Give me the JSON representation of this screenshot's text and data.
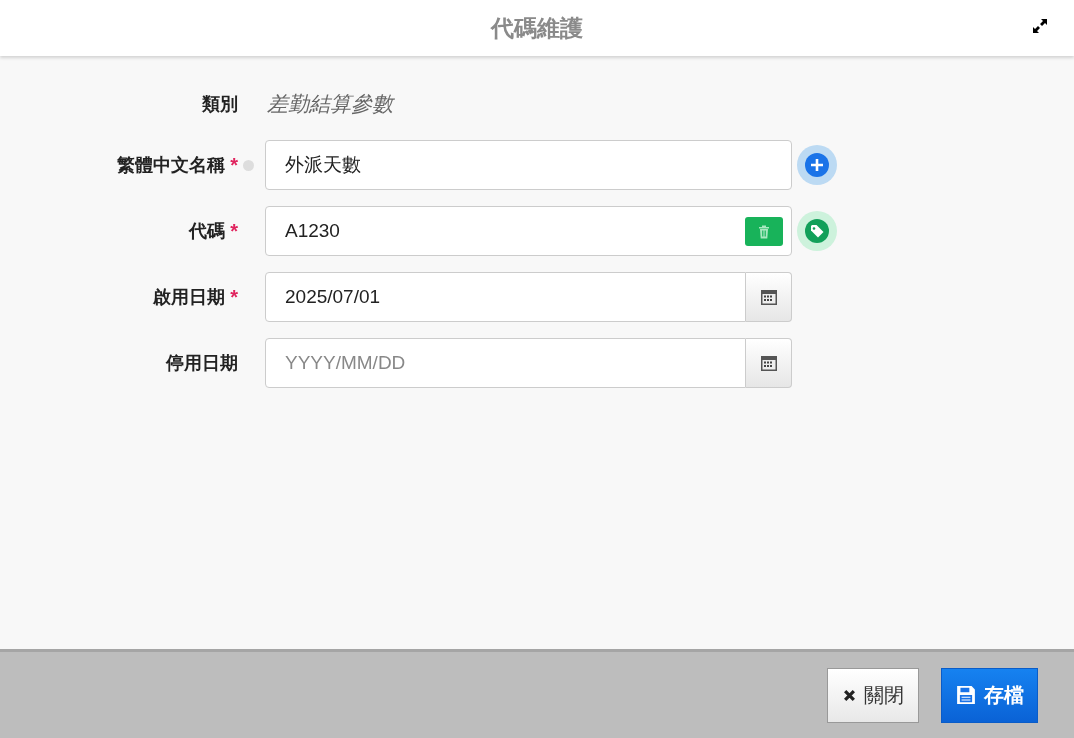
{
  "window": {
    "title": "代碼維護"
  },
  "required_mark": "*",
  "category": {
    "label": "類別",
    "value": "差勤結算參數"
  },
  "fields": [
    {
      "kind": "name",
      "label": "繁體中文名稱",
      "required": true,
      "value": "外派天數"
    },
    {
      "kind": "code",
      "label": "代碼",
      "required": true,
      "value": "A1230"
    },
    {
      "kind": "date",
      "label": "啟用日期",
      "required": true,
      "value": "2025/07/01"
    },
    {
      "kind": "date",
      "label": "停用日期",
      "required": false,
      "placeholder": "YYYY/MM/DD"
    }
  ],
  "buttons": [
    {
      "kind": "close",
      "label": "關閉"
    },
    {
      "kind": "save",
      "label": "存檔"
    }
  ]
}
